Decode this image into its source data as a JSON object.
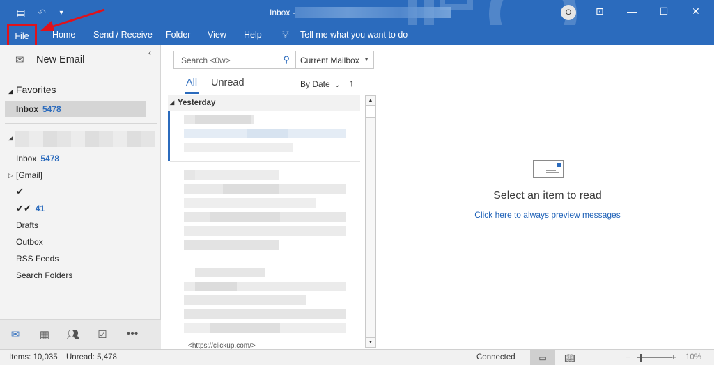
{
  "window": {
    "title_prefix": "Inbox -",
    "avatar_initial": "O",
    "qat_icons": [
      "outlook-icon",
      "undo-icon",
      "customize-qat-icon"
    ],
    "controls": [
      "ribbon-display-icon",
      "minimize-icon",
      "maximize-icon",
      "close-icon"
    ]
  },
  "ribbon": {
    "tabs": [
      "File",
      "Home",
      "Send / Receive",
      "Folder",
      "View",
      "Help"
    ],
    "tell_me": "Tell me what you want to do"
  },
  "folder_pane": {
    "new_email": "New Email",
    "favorites_label": "Favorites",
    "favorites": [
      {
        "label": "Inbox",
        "count": "5478"
      }
    ],
    "folders": [
      {
        "label": "Inbox",
        "count": "5478"
      },
      {
        "label": "[Gmail]",
        "count": ""
      },
      {
        "label": "✔",
        "count": ""
      },
      {
        "label": "✔✔",
        "count": "41"
      },
      {
        "label": "Drafts",
        "count": ""
      },
      {
        "label": "Outbox",
        "count": ""
      },
      {
        "label": "RSS Feeds",
        "count": ""
      },
      {
        "label": "Search Folders",
        "count": ""
      }
    ],
    "nav": [
      "mail-icon",
      "calendar-icon",
      "people-icon",
      "tasks-icon",
      "more-icon"
    ]
  },
  "message_list": {
    "search_placeholder": "Search <0w>",
    "scope": "Current Mailbox",
    "filter_all": "All",
    "filter_unread": "Unread",
    "sort_by": "By Date",
    "group_header": "Yesterday",
    "partial_preview": "<https://clickup.com/>"
  },
  "reading_pane": {
    "select_item": "Select an item to read",
    "preview_link": "Click here to always preview messages"
  },
  "status_bar": {
    "items": "Items: 10,035",
    "unread": "Unread: 5,478",
    "connection": "Connected",
    "zoom": "10%",
    "zoom_fraction": 0.1
  },
  "colors": {
    "brand": "#2b6bbd",
    "highlight": "#e0121b"
  }
}
